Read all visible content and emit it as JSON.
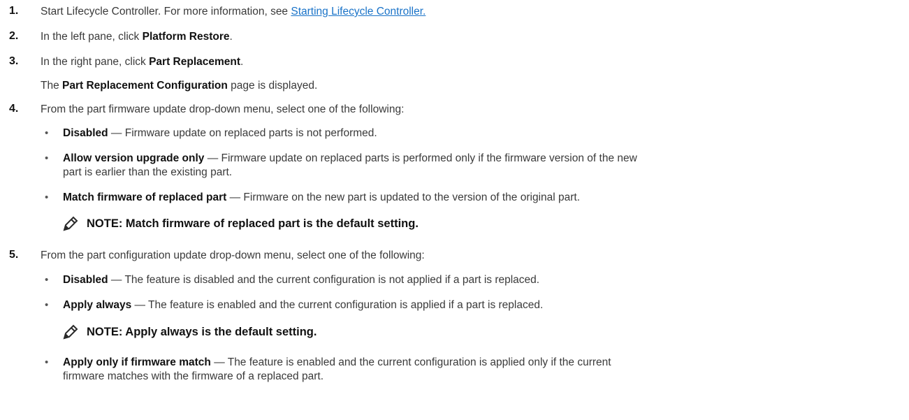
{
  "steps": [
    {
      "num": "1.",
      "pre": "Start Lifecycle Controller. For more information, see ",
      "link": "Starting Lifecycle Controller."
    },
    {
      "num": "2.",
      "pre": "In the left pane, click ",
      "bold": "Platform Restore",
      "post": "."
    },
    {
      "num": "3.",
      "pre": "In the right pane, click ",
      "bold": "Part Replacement",
      "post": "."
    },
    {
      "sub_pre": "The ",
      "sub_bold": "Part Replacement Configuration",
      "sub_post": " page is displayed."
    },
    {
      "num": "4.",
      "text": "From the part firmware update drop-down menu, select one of the following:"
    },
    {
      "num": "5.",
      "text": "From the part configuration update drop-down menu, select one of the following:"
    }
  ],
  "firmware_options": [
    {
      "bold": "Disabled",
      "text": " — Firmware update on replaced parts is not performed."
    },
    {
      "bold": "Allow version upgrade only",
      "text": " — Firmware update on replaced parts is performed only if the firmware version of the new",
      "cont": "part is earlier than the existing part."
    },
    {
      "bold": "Match firmware of replaced part",
      "text": " — Firmware on the new part is updated to the version of the original part."
    }
  ],
  "note1": "NOTE: Match firmware of replaced part is the default setting.",
  "config_options": [
    {
      "bold": "Disabled",
      "text": " — The feature is disabled and the current configuration is not applied if a part is replaced."
    },
    {
      "bold": "Apply always",
      "text": " — The feature is enabled and the current configuration is applied if a part is replaced."
    },
    {
      "bold": "Apply only if firmware match",
      "text": " — The feature is enabled and the current configuration is applied only if the current",
      "cont": "firmware matches with the firmware of a replaced part."
    }
  ],
  "note2": "NOTE: Apply always is the default setting.",
  "bullet_char": "•",
  "icons": {
    "note": "pencil-note-icon"
  }
}
